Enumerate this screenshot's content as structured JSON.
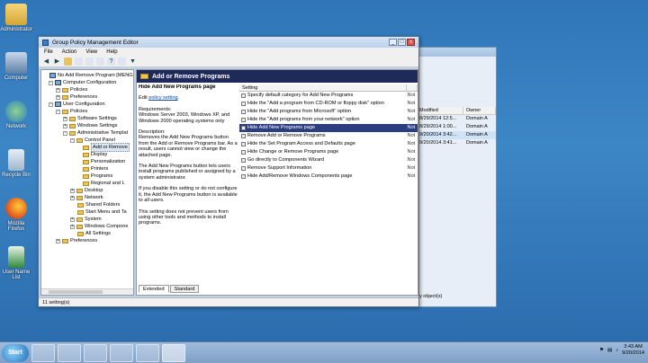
{
  "desktop": {
    "icons": [
      {
        "label": "Administrator"
      },
      {
        "label": "Computer"
      },
      {
        "label": "Network"
      },
      {
        "label": "Recycle Bin"
      },
      {
        "label": "Mozilla Firefox"
      },
      {
        "label": "User Name List"
      }
    ]
  },
  "bgwindow": {
    "headers": [
      "Modified",
      "Owner"
    ],
    "rows": [
      {
        "modified": "8/29/2014 12:5...",
        "owner": "Domain A"
      },
      {
        "modified": "8/29/2014 1:00...",
        "owner": "Domain A"
      },
      {
        "modified": "9/20/2014 3:42...",
        "owner": "Domain A"
      },
      {
        "modified": "9/20/2014 3:41...",
        "owner": "Domain A"
      }
    ],
    "status": "y object(s)"
  },
  "window": {
    "title": "Group Policy Management Editor",
    "close": "x"
  },
  "menu": [
    "File",
    "Action",
    "View",
    "Help"
  ],
  "tree": [
    "No Add Remove Program [MENGSR",
    "Computer Configuration",
    "Policies",
    "Preferences",
    "User Configuration",
    "Policies",
    "Software Settings",
    "Windows Settings",
    "Administrative Templat",
    "Control Panel",
    "Add or Remove",
    "Display",
    "Personalization",
    "Printers",
    "Programs",
    "Regional and L",
    "Desktop",
    "Network",
    "Shared Folders",
    "Start Menu and Ta",
    "System",
    "Windows Compone",
    "All Settings",
    "Preferences"
  ],
  "right": {
    "header": "Add or Remove Programs",
    "desc": {
      "title": "Hide Add New Programs page",
      "edit": "Edit ",
      "edit_link": "policy setting",
      "edit_suffix": ".",
      "req": "Requirements:\nWindows Server 2003, Windows XP, and Windows 2000 operating systems only",
      "description": "Description:\nRemoves the Add New Programs button from the Add or Remove Programs bar. As a result, users cannot view or change the attached page.",
      "p1": "The Add New Programs button lets users install programs published or assigned by a system administrator.",
      "p2": "If you disable this setting or do not configure it, the Add New Programs button is available to all users.",
      "p3": "This setting does not prevent users from using other tools and methods to install programs."
    },
    "list_header": {
      "setting": "Setting"
    },
    "settings": [
      {
        "name": "Specify default category for Add New Programs",
        "state": "Not"
      },
      {
        "name": "Hide the \"Add a program from CD-ROM or floppy disk\" option",
        "state": "Not"
      },
      {
        "name": "Hide the \"Add programs from Microsoft\" option",
        "state": "Not"
      },
      {
        "name": "Hide the \"Add programs from your network\" option",
        "state": "Not"
      },
      {
        "name": "Hide Add New Programs page",
        "state": "Not"
      },
      {
        "name": "Remove Add or Remove Programs",
        "state": "Not"
      },
      {
        "name": "Hide the Set Program Access and Defaults page",
        "state": "Not"
      },
      {
        "name": "Hide Change or Remove Programs page",
        "state": "Not"
      },
      {
        "name": "Go directly to Components Wizard",
        "state": "Not"
      },
      {
        "name": "Remove Support Information",
        "state": "Not"
      },
      {
        "name": "Hide Add/Remove Windows Components page",
        "state": "Not"
      }
    ],
    "tabs": [
      "Extended",
      "Standard"
    ]
  },
  "status": "11 setting(s)",
  "taskbar": {
    "start": "Start",
    "time": "3:43 AM",
    "date": "9/20/2014"
  }
}
